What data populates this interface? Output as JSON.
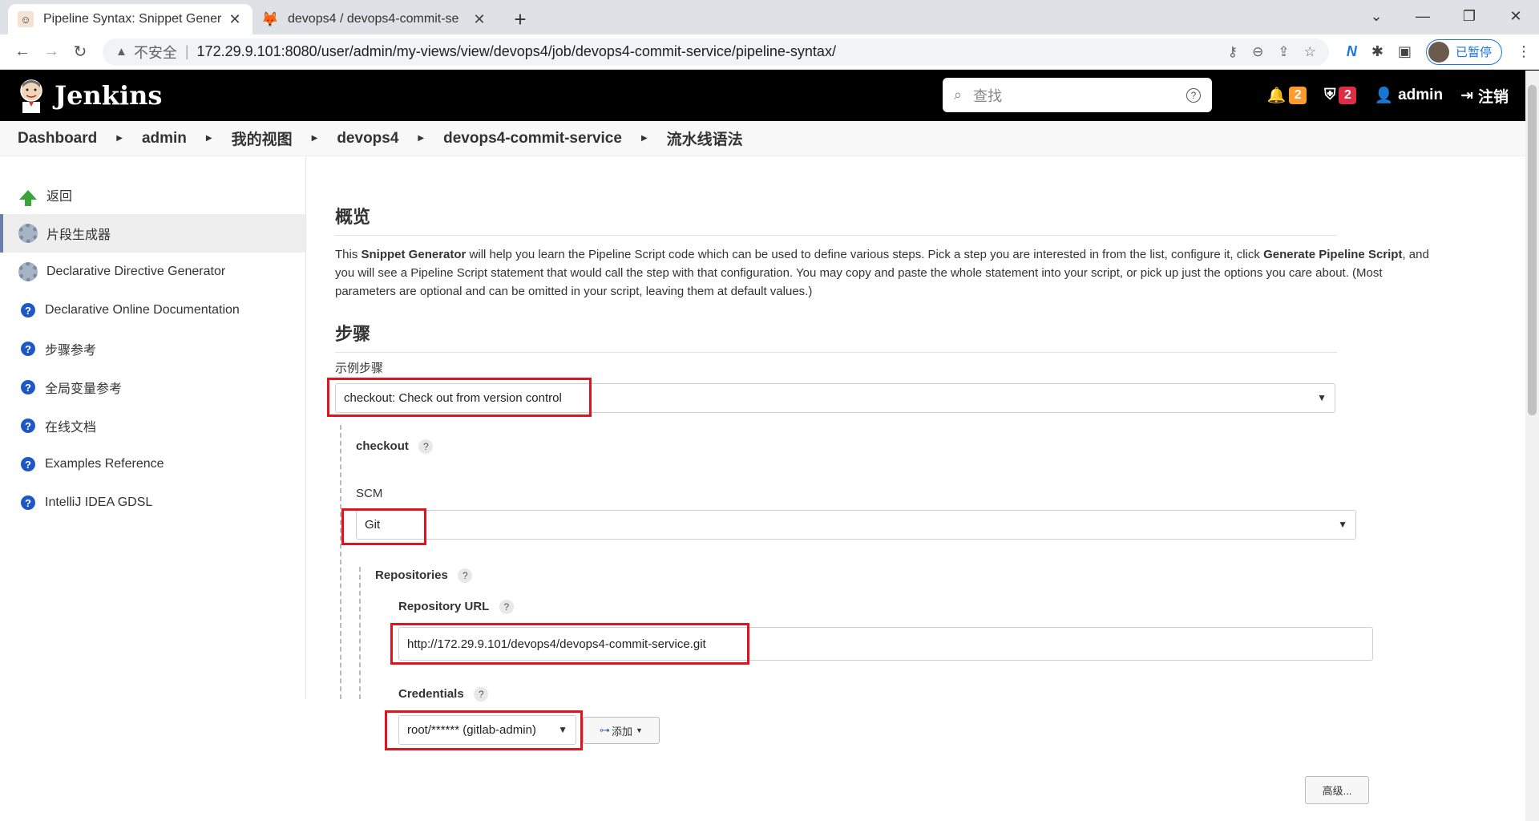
{
  "browser": {
    "tabs": [
      {
        "title": "Pipeline Syntax: Snippet Gener",
        "active": true
      },
      {
        "title": "devops4 / devops4-commit-se",
        "active": false
      }
    ],
    "insecure_label": "不安全",
    "url": "172.29.9.101:8080/user/admin/my-views/view/devops4/job/devops4-commit-service/pipeline-syntax/",
    "profile_label": "已暂停"
  },
  "jenkins": {
    "logo_text": "Jenkins",
    "search_placeholder": "查找",
    "notifications_count": "2",
    "security_count": "2",
    "user": "admin",
    "logout": "注销"
  },
  "breadcrumb": [
    "Dashboard",
    "admin",
    "我的视图",
    "devops4",
    "devops4-commit-service",
    "流水线语法"
  ],
  "sidebar": {
    "items": [
      {
        "label": "返回",
        "icon": "up-arrow-icon"
      },
      {
        "label": "片段生成器",
        "icon": "gear-icon",
        "active": true
      },
      {
        "label": "Declarative Directive Generator",
        "icon": "gear-icon"
      },
      {
        "label": "Declarative Online Documentation",
        "icon": "help-icon"
      },
      {
        "label": "步骤参考",
        "icon": "help-icon"
      },
      {
        "label": "全局变量参考",
        "icon": "help-icon"
      },
      {
        "label": "在线文档",
        "icon": "help-icon"
      },
      {
        "label": "Examples Reference",
        "icon": "help-icon"
      },
      {
        "label": "IntelliJ IDEA GDSL",
        "icon": "help-icon"
      }
    ]
  },
  "main": {
    "overview_title": "概览",
    "desc": {
      "p1": "This ",
      "b1": "Snippet Generator",
      "p2": " will help you learn the Pipeline Script code which can be used to define various steps. Pick a step you are interested in from the list, configure it, click ",
      "b2": "Generate Pipeline Script",
      "p3": ", and you will see a Pipeline Script statement that would call the step with that configuration. You may copy and paste the whole statement into your script, or pick up just the options you care about. (Most parameters are optional and can be omitted in your script, leaving them at default values.)"
    },
    "steps_title": "步骤",
    "sample_step_label": "示例步骤",
    "sample_step_value": "checkout: Check out from version control",
    "checkout_label": "checkout",
    "scm_label": "SCM",
    "scm_value": "Git",
    "repositories_label": "Repositories",
    "repo_url_label": "Repository URL",
    "repo_url_value": "http://172.29.9.101/devops4/devops4-commit-service.git",
    "credentials_label": "Credentials",
    "credentials_value": "root/****** (gitlab-admin)",
    "add_button": "添加",
    "advanced_button": "高级..."
  },
  "colors": {
    "highlight_red": "#e0141e",
    "jenkins_header": "#000000",
    "help_blue": "#1e58c7"
  }
}
